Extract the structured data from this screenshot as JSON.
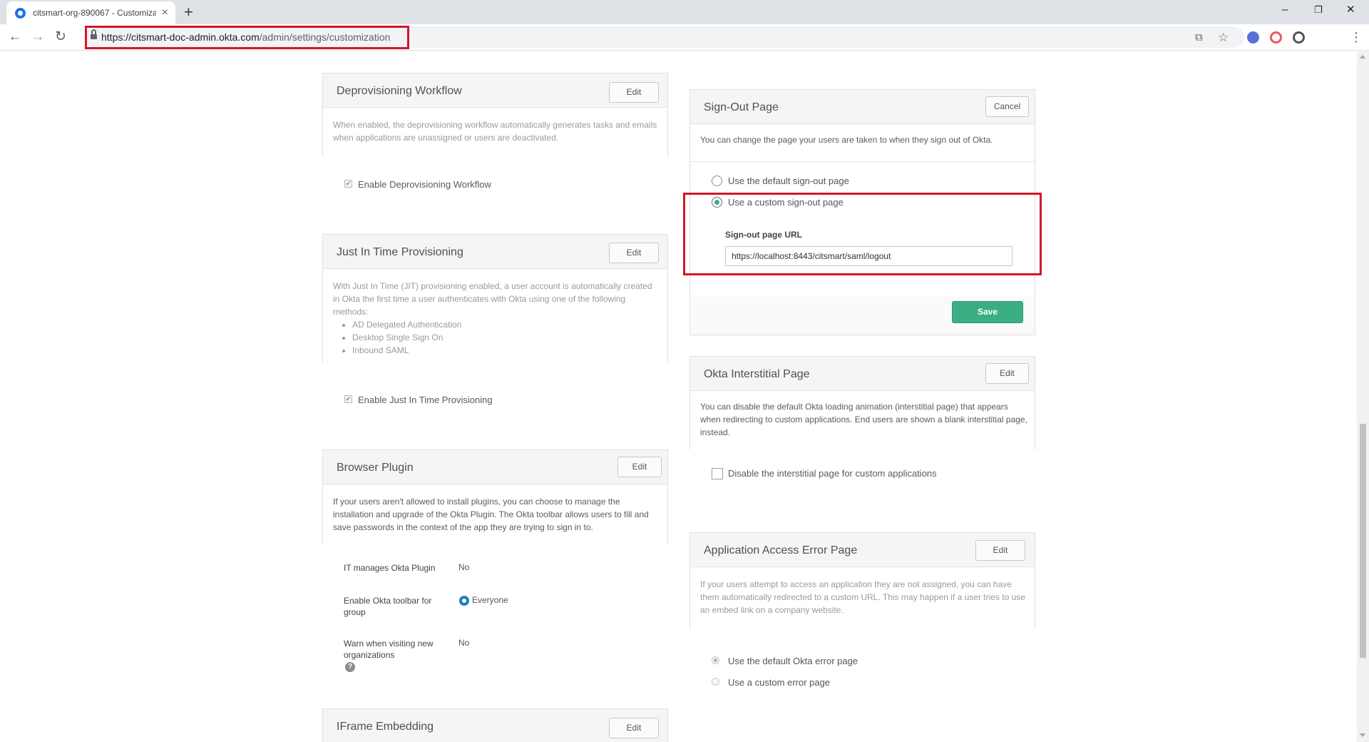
{
  "browser": {
    "tab_title": "citsmart-org-890067 - Customiza",
    "tab_close": "×",
    "new_tab": "+",
    "url_host": "https://citsmart-doc-admin.okta.com",
    "url_path": "/admin/settings/customization",
    "window_minimize": "–",
    "window_restore": "❐",
    "window_close": "✕",
    "nav_back": "←",
    "nav_forward": "→",
    "nav_reload": "↻",
    "translate_icon": "⧉",
    "star_icon": "☆",
    "menu_icon": "⋮"
  },
  "deprovisioning": {
    "title": "Deprovisioning Workflow",
    "edit": "Edit",
    "description": "When enabled, the deprovisioning workflow automatically generates tasks and emails when applications are unassigned or users are deactivated.",
    "checkbox_label": "Enable Deprovisioning Workflow",
    "checkbox_mark": "✔"
  },
  "jit": {
    "title": "Just In Time Provisioning",
    "edit": "Edit",
    "description": "With Just In Time (JIT) provisioning enabled, a user account is automatically created in Okta the first time a user authenticates with Okta using one of the following methods:",
    "methods": [
      "AD Delegated Authentication",
      "Desktop Single Sign On",
      "Inbound SAML"
    ],
    "checkbox_label": "Enable Just In Time Provisioning",
    "checkbox_mark": "✔"
  },
  "browser_plugin": {
    "title": "Browser Plugin",
    "edit": "Edit",
    "description": "If your users aren't allowed to install plugins, you can choose to manage the installation and upgrade of the Okta Plugin. The Okta toolbar allows users to fill and save passwords in the context of the app they are trying to sign in to.",
    "it_manages_label": "IT manages Okta Plugin",
    "it_manages_value": "No",
    "toolbar_group_label": "Enable Okta toolbar for group",
    "toolbar_group_value": "Everyone",
    "warn_label": "Warn when visiting new organizations",
    "warn_value": "No",
    "help": "?"
  },
  "iframe": {
    "title": "IFrame Embedding",
    "edit": "Edit"
  },
  "signout": {
    "title": "Sign-Out Page",
    "cancel": "Cancel",
    "description": "You can change the page your users are taken to when they sign out of Okta.",
    "option_default": "Use the default sign-out page",
    "option_custom": "Use a custom sign-out page",
    "url_label": "Sign-out page URL",
    "url_value": "https://localhost:8443/citsmart/saml/logout",
    "save": "Save"
  },
  "interstitial": {
    "title": "Okta Interstitial Page",
    "edit": "Edit",
    "description": "You can disable the default Okta loading animation (interstitial page) that appears when redirecting to custom applications. End users are shown a blank interstitial page, instead.",
    "checkbox_label": "Disable the interstitial page for custom applications"
  },
  "app_error": {
    "title": "Application Access Error Page",
    "edit": "Edit",
    "description": "If your users attempt to access an application they are not assigned, you can have them automatically redirected to a custom URL. This may happen if a user tries to use an embed link on a company website.",
    "option_default": "Use the default Okta error page",
    "option_custom": "Use a custom error page"
  }
}
